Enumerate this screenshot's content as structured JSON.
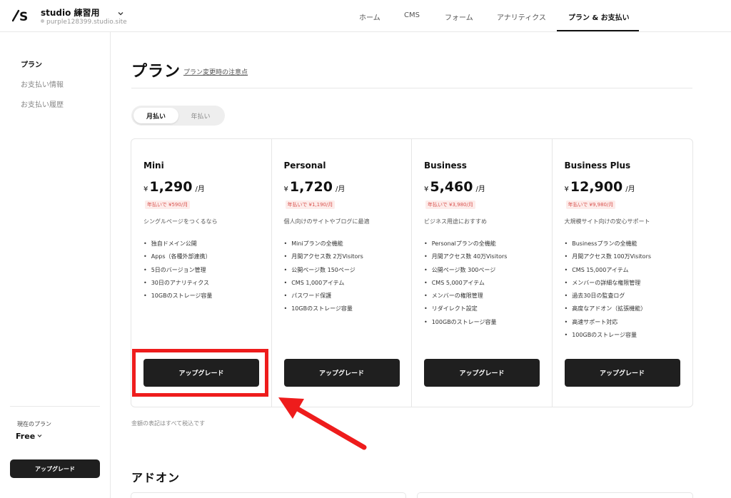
{
  "header": {
    "site_name": "studio 練習用",
    "site_url": "purple128399.studio.site",
    "nav": [
      {
        "label": "ホーム",
        "active": false
      },
      {
        "label": "CMS",
        "active": false
      },
      {
        "label": "フォーム",
        "active": false
      },
      {
        "label": "アナリティクス",
        "active": false
      },
      {
        "label": "プラン & お支払い",
        "active": true
      }
    ]
  },
  "sidebar": {
    "items": [
      {
        "label": "プラン",
        "active": true
      },
      {
        "label": "お支払い情報",
        "active": false
      },
      {
        "label": "お支払い履歴",
        "active": false
      }
    ],
    "current_plan_label": "現在のプラン",
    "current_plan_value": "Free",
    "upgrade_label": "アップグレード"
  },
  "main": {
    "title": "プラン",
    "note_link": "プラン変更時の注意点",
    "billing_toggle": [
      {
        "label": "月払い",
        "active": true
      },
      {
        "label": "年払い",
        "active": false
      }
    ],
    "currency": "¥",
    "per_month": "/月",
    "plans": [
      {
        "name": "Mini",
        "price": "1,290",
        "yearly": "年払いで ¥590/月",
        "description": "シングルページをつくるなら",
        "features": [
          "独自ドメイン公開",
          "Apps（各種外部連携）",
          "5日のバージョン管理",
          "30日のアナリティクス",
          "10GBのストレージ容量"
        ],
        "button": "アップグレード"
      },
      {
        "name": "Personal",
        "price": "1,720",
        "yearly": "年払いで ¥1,190/月",
        "description": "個人向けのサイトやブログに最適",
        "features": [
          "Miniプランの全機能",
          "月間アクセス数 2万Visitors",
          "公開ページ数 150ページ",
          "CMS 1,000アイテム",
          "パスワード保護",
          "10GBのストレージ容量"
        ],
        "button": "アップグレード"
      },
      {
        "name": "Business",
        "price": "5,460",
        "yearly": "年払いで ¥3,980/月",
        "description": "ビジネス用途におすすめ",
        "features": [
          "Personalプランの全機能",
          "月間アクセス数 40万Visitors",
          "公開ページ数 300ページ",
          "CMS 5,000アイテム",
          "メンバーの権限管理",
          "リダイレクト設定",
          "100GBのストレージ容量"
        ],
        "button": "アップグレード"
      },
      {
        "name": "Business Plus",
        "price": "12,900",
        "yearly": "年払いで ¥9,980/月",
        "description": "大規模サイト向けの安心サポート",
        "features": [
          "Businessプランの全機能",
          "月間アクセス数 100万Visitors",
          "CMS 15,000アイテム",
          "メンバーの詳細な権限管理",
          "過去30日の監査ログ",
          "高度なアドオン（拡張機能）",
          "高速サポート対応",
          "100GBのストレージ容量"
        ],
        "button": "アップグレード"
      }
    ],
    "tax_note": "金額の表記はすべて税込です",
    "addon_title": "アドオン"
  },
  "colors": {
    "accent_dark": "#1f1f1f",
    "annotation_red": "#ee1c1c",
    "price_note_red": "#d9534f"
  }
}
